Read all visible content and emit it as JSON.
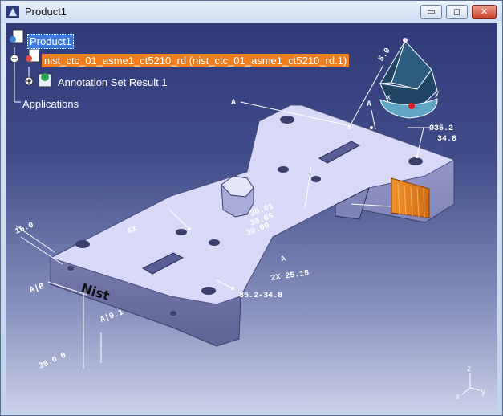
{
  "window": {
    "title": "Product1",
    "buttons": {
      "minimize": "▭",
      "maximize": "◻",
      "close": "✕"
    }
  },
  "tree": {
    "root": "Product1",
    "part": "nist_ctc_01_asme1_ct5210_rd (nist_ctc_01_asme1_ct5210_rd.1)",
    "annotation_set": "Annotation Set Result.1",
    "applications": "Applications"
  },
  "annotations": {
    "label_a1": "A",
    "label_a2": "A",
    "label_a3": "A",
    "label_ab": "A|B",
    "dim_35_2": "Ø35.2",
    "dim_34_8": "34.8",
    "dim_50": "5.0",
    "dim_30a": "30.01",
    "dim_30b": "30.05",
    "dim_30c": "30.00",
    "dim_6x": "6X",
    "dim_35_34": "35.2-34.8",
    "dim_2x25": "2X 25.15",
    "dim_15_a": "15.0",
    "dim_ab_a": "A|0.1",
    "dim_bottom": "38.0 0"
  },
  "compass": {
    "x": "x",
    "y": "y"
  },
  "axes": {
    "x": "x",
    "y": "y",
    "z": "z"
  },
  "logo": "Nist",
  "colors": {
    "part_top": "#d7d9f6",
    "part_side": "#8b8fc0",
    "highlight": "#e8781a",
    "selection_blue": "#3e78d8",
    "selection_orange": "#f07d1e"
  }
}
